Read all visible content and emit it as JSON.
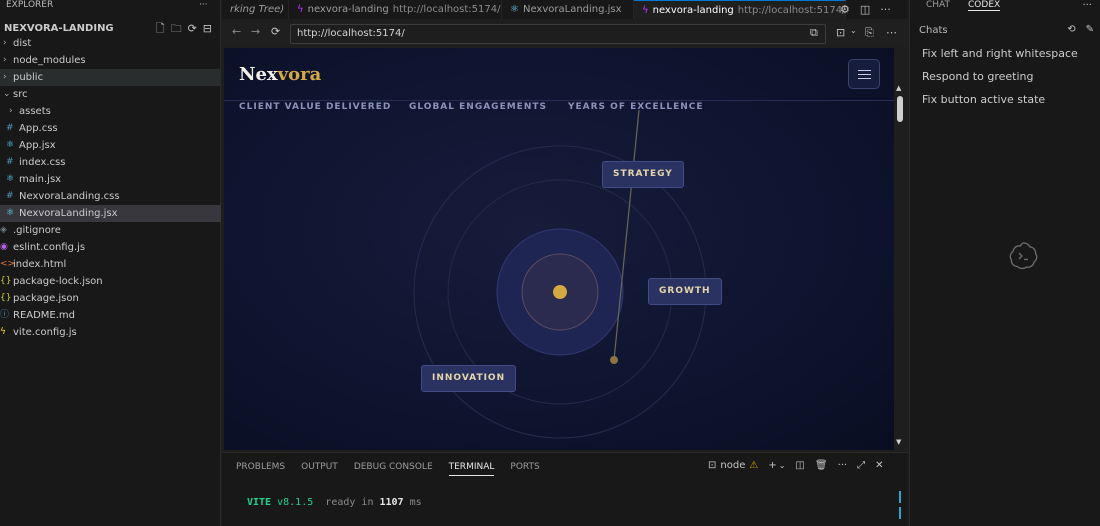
{
  "explorer": {
    "title": "EXPLORER",
    "title_more": "···",
    "project": "NEXVORA-LANDING",
    "actions": [
      "new-file-icon",
      "new-folder-icon",
      "refresh-icon",
      "collapse-all-icon"
    ],
    "items": [
      {
        "label": "dist",
        "type": "folder",
        "depth": 0
      },
      {
        "label": "node_modules",
        "type": "folder",
        "depth": 0
      },
      {
        "label": "public",
        "type": "folder",
        "depth": 0
      },
      {
        "label": "src",
        "type": "folder-open",
        "depth": 0
      },
      {
        "label": "assets",
        "type": "folder",
        "depth": 1
      },
      {
        "label": "App.css",
        "type": "css",
        "depth": 1
      },
      {
        "label": "App.jsx",
        "type": "jsx",
        "depth": 1
      },
      {
        "label": "index.css",
        "type": "css",
        "depth": 1
      },
      {
        "label": "main.jsx",
        "type": "jsx",
        "depth": 1
      },
      {
        "label": "NexvoraLanding.css",
        "type": "css",
        "depth": 1
      },
      {
        "label": "NexvoraLanding.jsx",
        "type": "jsx",
        "depth": 1
      },
      {
        "label": ".gitignore",
        "type": "git",
        "depth": 0
      },
      {
        "label": "eslint.config.js",
        "type": "eslint",
        "depth": 0
      },
      {
        "label": "index.html",
        "type": "html",
        "depth": 0
      },
      {
        "label": "package-lock.json",
        "type": "json",
        "depth": 0
      },
      {
        "label": "package.json",
        "type": "json",
        "depth": 0
      },
      {
        "label": "README.md",
        "type": "info",
        "depth": 0
      },
      {
        "label": "vite.config.js",
        "type": "vite",
        "depth": 0
      }
    ]
  },
  "tabs": [
    {
      "title": "rking Tree)",
      "url": "",
      "icon": "",
      "active": false
    },
    {
      "title": "nexvora-landing",
      "url": "http://localhost:5174/",
      "icon": "vite",
      "active": false
    },
    {
      "title": "NexvoraLanding.jsx",
      "url": "",
      "icon": "react",
      "active": false
    },
    {
      "title": "nexvora-landing",
      "url": "http://localhost:5174/",
      "icon": "vite",
      "active": true
    }
  ],
  "browser": {
    "address": "http://localhost:5174/"
  },
  "page": {
    "logo_main": "Nex",
    "logo_accent": "vora",
    "stats": [
      "CLIENT VALUE DELIVERED",
      "GLOBAL ENGAGEMENTS",
      "YEARS OF EXCELLENCE"
    ],
    "pills": {
      "strategy": "STRATEGY",
      "growth": "GROWTH",
      "innovation": "INNOVATION"
    }
  },
  "panel": {
    "tabs": [
      "PROBLEMS",
      "OUTPUT",
      "DEBUG CONSOLE",
      "TERMINAL",
      "PORTS"
    ],
    "active_tab": "TERMINAL",
    "terminal_name": "node",
    "term_vite": "VITE",
    "term_version": "v8.1.5",
    "term_ready": "ready in",
    "term_ms": "1107",
    "term_unit": "ms"
  },
  "chat": {
    "tabs": [
      "CHAT",
      "CODEX"
    ],
    "active_tab": "CODEX",
    "section": "Chats",
    "items": [
      "Fix left and right whitespace",
      "Respond to greeting",
      "Fix button active state"
    ]
  },
  "colors": {
    "accent_gold": "#d4a843",
    "vscode_blue": "#0078d4",
    "vite_purple": "#bd34fe",
    "terminal_green": "#23d18b"
  }
}
